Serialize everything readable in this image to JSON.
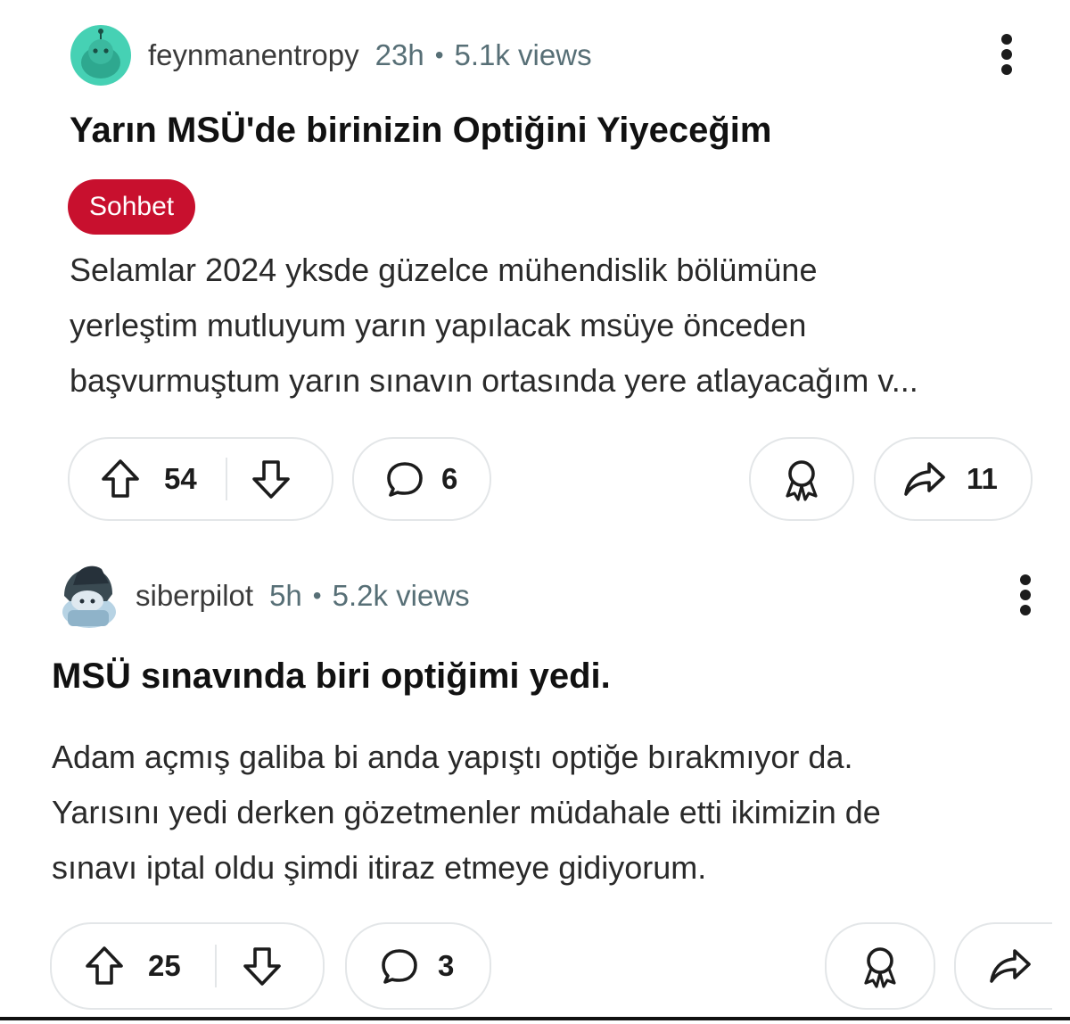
{
  "posts": [
    {
      "username": "feynmanentropy",
      "age": "23h",
      "separator": "•",
      "views": "5.1k views",
      "title": "Yarın MSÜ'de birinizin Optiğini Yiyeceğim",
      "flair": "Sohbet",
      "body_lines": [
        "Selamlar 2024 yksde güzelce mühendislik bölümüne",
        "yerleştim mutluyum yarın yapılacak msüye önceden",
        "başvurmuştum yarın sınavın ortasında yere atlayacağım v..."
      ],
      "upvotes": "54",
      "comments": "6",
      "shares": "11",
      "icons": [
        "avatar-snoo",
        "more-vertical-icon",
        "upvote-arrow-icon",
        "downvote-arrow-icon",
        "comment-bubble-icon",
        "award-ribbon-icon",
        "share-arrow-icon"
      ],
      "avatar_color": "#46d1b4"
    },
    {
      "username": "siberpilot",
      "age": "5h",
      "separator": "•",
      "views": "5.2k views",
      "title": "MSÜ sınavında biri optiğimi yedi.",
      "body_lines": [
        "Adam açmış galiba bi anda yapıştı optiğe bırakmıyor da.",
        "Yarısını yedi derken gözetmenler müdahale etti ikimizin de",
        "sınavı iptal oldu şimdi itiraz etmeye gidiyorum."
      ],
      "upvotes": "25",
      "comments": "3",
      "icons": [
        "avatar-snoo-hat",
        "more-vertical-icon",
        "upvote-arrow-icon",
        "downvote-arrow-icon",
        "comment-bubble-icon",
        "award-ribbon-icon",
        "share-arrow-icon"
      ],
      "avatar_color": "#8fb3c9"
    }
  ]
}
